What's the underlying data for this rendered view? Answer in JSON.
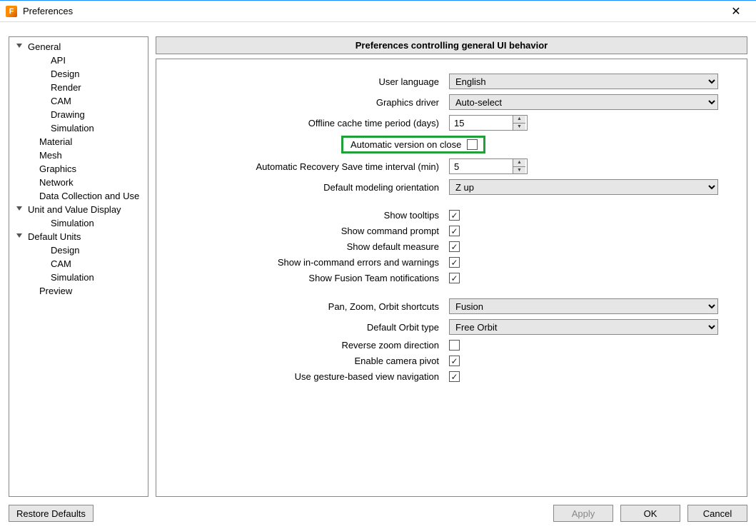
{
  "window": {
    "title": "Preferences",
    "close": "✕"
  },
  "sidebar": {
    "items": [
      {
        "label": "General",
        "cls": "expandable"
      },
      {
        "label": "API",
        "cls": "level2"
      },
      {
        "label": "Design",
        "cls": "level2"
      },
      {
        "label": "Render",
        "cls": "level2"
      },
      {
        "label": "CAM",
        "cls": "level2"
      },
      {
        "label": "Drawing",
        "cls": "level2"
      },
      {
        "label": "Simulation",
        "cls": "level2"
      },
      {
        "label": "Material",
        "cls": "level1"
      },
      {
        "label": "Mesh",
        "cls": "level1"
      },
      {
        "label": "Graphics",
        "cls": "level1"
      },
      {
        "label": "Network",
        "cls": "level1"
      },
      {
        "label": "Data Collection and Use",
        "cls": "level1"
      },
      {
        "label": "Unit and Value Display",
        "cls": "expandable"
      },
      {
        "label": "Simulation",
        "cls": "level2"
      },
      {
        "label": "Default Units",
        "cls": "expandable"
      },
      {
        "label": "Design",
        "cls": "level2"
      },
      {
        "label": "CAM",
        "cls": "level2"
      },
      {
        "label": "Simulation",
        "cls": "level2"
      },
      {
        "label": "Preview",
        "cls": "level1"
      }
    ]
  },
  "banner": "Preferences controlling general UI behavior",
  "settings": {
    "user_language": {
      "label": "User language",
      "value": "English"
    },
    "graphics_driver": {
      "label": "Graphics driver",
      "value": "Auto-select"
    },
    "offline_cache": {
      "label": "Offline cache time period (days)",
      "value": "15"
    },
    "auto_version_close": {
      "label": "Automatic version on close",
      "checked": false
    },
    "auto_recovery": {
      "label": "Automatic Recovery Save time interval (min)",
      "value": "5"
    },
    "default_orientation": {
      "label": "Default modeling orientation",
      "value": "Z up"
    },
    "show_tooltips": {
      "label": "Show tooltips",
      "checked": true
    },
    "show_cmd_prompt": {
      "label": "Show command prompt",
      "checked": true
    },
    "show_default_measure": {
      "label": "Show default measure",
      "checked": true
    },
    "show_incmd_errors": {
      "label": "Show in-command errors and warnings",
      "checked": true
    },
    "show_fusion_team": {
      "label": "Show Fusion Team notifications",
      "checked": true
    },
    "pan_zoom_orbit": {
      "label": "Pan, Zoom, Orbit shortcuts",
      "value": "Fusion"
    },
    "default_orbit": {
      "label": "Default Orbit type",
      "value": "Free Orbit"
    },
    "reverse_zoom": {
      "label": "Reverse zoom direction",
      "checked": false
    },
    "enable_camera_pivot": {
      "label": "Enable camera pivot",
      "checked": true
    },
    "gesture_nav": {
      "label": "Use gesture-based view navigation",
      "checked": true
    }
  },
  "footer": {
    "restore": "Restore Defaults",
    "apply": "Apply",
    "ok": "OK",
    "cancel": "Cancel"
  },
  "glyphs": {
    "check": "✓",
    "up": "▲",
    "down": "▼"
  }
}
